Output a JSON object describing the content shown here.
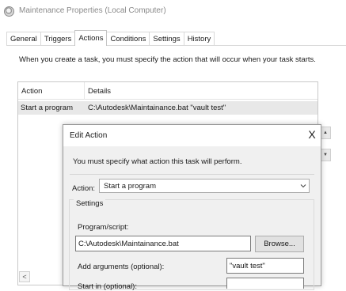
{
  "window": {
    "title": "Maintenance Properties (Local Computer)"
  },
  "tabs": [
    {
      "label": "General"
    },
    {
      "label": "Triggers"
    },
    {
      "label": "Actions",
      "active": true
    },
    {
      "label": "Conditions"
    },
    {
      "label": "Settings"
    },
    {
      "label": "History"
    }
  ],
  "actions_page": {
    "intro": "When you create a task, you must specify the action that will occur when your task starts.",
    "columns": {
      "action": "Action",
      "details": "Details"
    },
    "rows": [
      {
        "action": "Start a program",
        "details": "C:\\Autodesk\\Maintainance.bat \"vault test\""
      }
    ],
    "scroll_left_glyph": "<",
    "move_up_glyph": "▲",
    "move_down_glyph": "▼"
  },
  "edit_action": {
    "title": "Edit Action",
    "close_glyph": "X",
    "message": "You must specify what action this task will perform.",
    "action_label": "Action:",
    "action_value": "Start a program",
    "settings_label": "Settings",
    "program_label": "Program/script:",
    "program_value": "C:\\Autodesk\\Maintainance.bat",
    "browse_label": "Browse...",
    "arguments_label": "Add arguments (optional):",
    "arguments_value": "\"vault test\"",
    "start_in_label": "Start in (optional):"
  },
  "colors": {
    "selected_row": "#e8e8e8",
    "dialog_body": "#f0f0f0",
    "title_text": "#8a8a8a"
  }
}
